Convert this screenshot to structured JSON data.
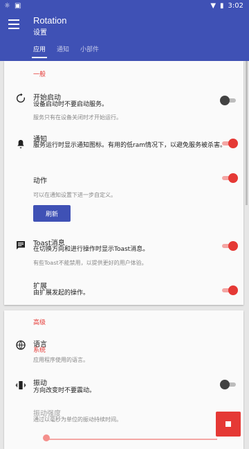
{
  "status": {
    "time": "3:02"
  },
  "app": {
    "title": "Rotation",
    "subtitle": "设置"
  },
  "tabs": [
    {
      "label": "应用"
    },
    {
      "label": "通知"
    },
    {
      "label": "小部件"
    }
  ],
  "sections": {
    "general": "一般",
    "advanced": "高级"
  },
  "items": {
    "start": {
      "title": "开始启动",
      "desc": "设备启动时不要启动服务。",
      "hint": "服务只有在设备关闭时才开始运行。",
      "toggle": false,
      "icon": "restart-icon"
    },
    "notify": {
      "title": "通知",
      "desc": "服务运行时显示通知图标。有用的低ram情况下，以避免服务被杀害。",
      "toggle": true,
      "icon": "bell-icon"
    },
    "action": {
      "title": "动作",
      "hint": "可以在通知设置下进一步自定义。",
      "toggle": true,
      "button": "刷新"
    },
    "toast": {
      "title": "Toast消息",
      "desc": "在切换方向和进行操作时显示Toast消息。",
      "hint": "有些Toast不能禁用，以提供更好的用户体验。",
      "toggle": true,
      "icon": "message-icon"
    },
    "ext": {
      "title": "扩展",
      "desc": "由扩展发起的操作。",
      "toggle": true
    },
    "lang": {
      "title": "语言",
      "value": "系统",
      "hint": "应用程序使用的语言。",
      "icon": "globe-icon"
    },
    "vib": {
      "title": "振动",
      "desc": "方向改变时不要震动。",
      "toggle": false,
      "icon": "vibration-icon"
    },
    "vibint": {
      "title": "振动强度",
      "hint": "通过以毫秒为单位的振动持续时间。"
    }
  },
  "colors": {
    "primary": "#3f51b5",
    "accent": "#e53935"
  }
}
